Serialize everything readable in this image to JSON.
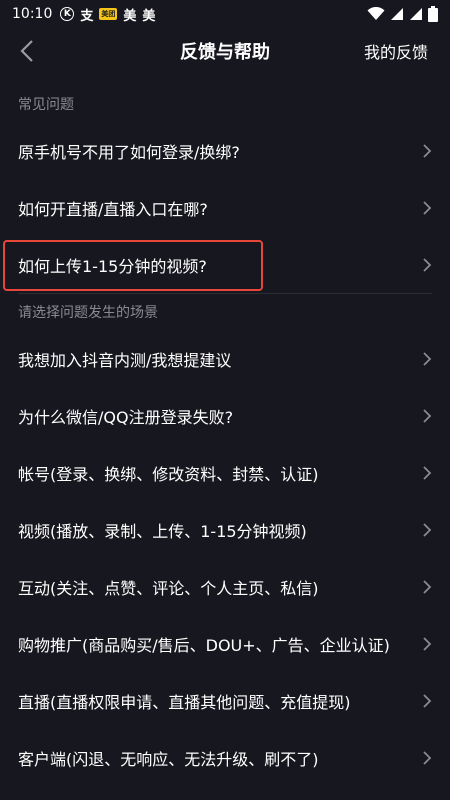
{
  "status_bar": {
    "time": "10:10",
    "icon_k": "K",
    "icon_zhi": "支",
    "icon_meituan": "美团",
    "icon_mei1": "美",
    "icon_mei2": "美"
  },
  "nav": {
    "title": "反馈与帮助",
    "right_link": "我的反馈"
  },
  "common": {
    "header": "常见问题",
    "items": [
      {
        "label": "原手机号不用了如何登录/换绑?"
      },
      {
        "label": "如何开直播/直播入口在哪?"
      },
      {
        "label": "如何上传1-15分钟的视频?",
        "highlighted": true
      }
    ]
  },
  "scenes": {
    "header": "请选择问题发生的场景",
    "items": [
      {
        "label": "我想加入抖音内测/我想提建议"
      },
      {
        "label": "为什么微信/QQ注册登录失败?"
      },
      {
        "label": "帐号(登录、换绑、修改资料、封禁、认证)"
      },
      {
        "label": "视频(播放、录制、上传、1-15分钟视频)"
      },
      {
        "label": "互动(关注、点赞、评论、个人主页、私信)"
      },
      {
        "label": "购物推广(商品购买/售后、DOU+、广告、企业认证)"
      },
      {
        "label": "直播(直播权限申请、直播其他问题、充值提现)"
      },
      {
        "label": "客户端(闪退、无响应、无法升级、刷不了)"
      }
    ]
  },
  "colors": {
    "background": "#17171f",
    "highlight": "#e8463a",
    "muted_text": "#8a8a92"
  }
}
